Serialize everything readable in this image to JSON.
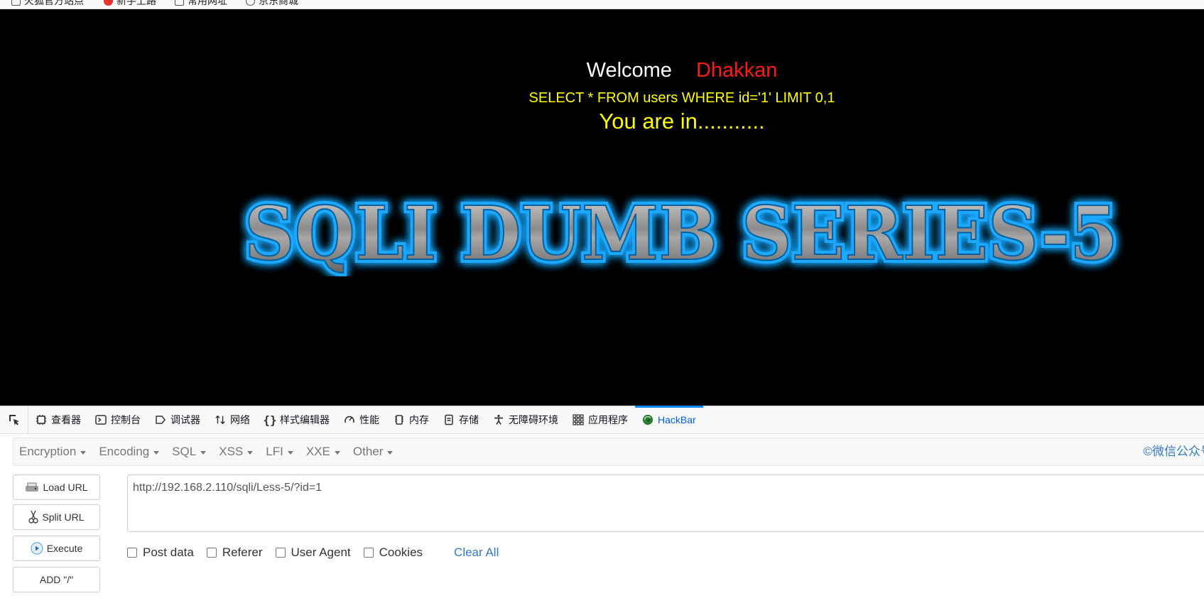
{
  "bookmarks": [
    {
      "label": "火狐官方站点",
      "icon": "page-icon"
    },
    {
      "label": "新手上路",
      "icon": "firefox-red-icon"
    },
    {
      "label": "常用网址",
      "icon": "page-icon"
    },
    {
      "label": "京东商城",
      "icon": "globe-icon"
    }
  ],
  "page": {
    "welcome": "Welcome",
    "name": "Dhakkan",
    "query": "SELECT * FROM users WHERE id='1' LIMIT 0,1",
    "message": "You are in...........",
    "banner_text": "SQLI DUMB SERIES-5",
    "colors": {
      "welcome": "#ffffff",
      "name": "#ff1a1a",
      "query": "#ffff00",
      "banner_glow": "#1aa8ff"
    }
  },
  "devtools": {
    "tabs": [
      {
        "label": "查看器",
        "icon": "inspector-icon"
      },
      {
        "label": "控制台",
        "icon": "console-icon"
      },
      {
        "label": "调试器",
        "icon": "debugger-icon"
      },
      {
        "label": "网络",
        "icon": "network-icon"
      },
      {
        "label": "样式编辑器",
        "icon": "style-editor-icon"
      },
      {
        "label": "性能",
        "icon": "performance-icon"
      },
      {
        "label": "内存",
        "icon": "memory-icon"
      },
      {
        "label": "存储",
        "icon": "storage-icon"
      },
      {
        "label": "无障碍环境",
        "icon": "accessibility-icon"
      },
      {
        "label": "应用程序",
        "icon": "application-icon"
      },
      {
        "label": "HackBar",
        "icon": "hackbar-icon",
        "active": true
      }
    ]
  },
  "hackbar": {
    "menu": [
      "Encryption",
      "Encoding",
      "SQL",
      "XSS",
      "LFI",
      "XXE",
      "Other"
    ],
    "watermark": "©微信公众号",
    "buttons": {
      "load_url": "Load URL",
      "split_url": "Split URL",
      "execute": "Execute",
      "add_slash": "ADD \"/\""
    },
    "url": "http://192.168.2.110/sqli/Less-5/?id=1",
    "options": [
      "Post data",
      "Referer",
      "User Agent",
      "Cookies"
    ],
    "clear_all": "Clear All",
    "accent_color": "#337ab7"
  }
}
